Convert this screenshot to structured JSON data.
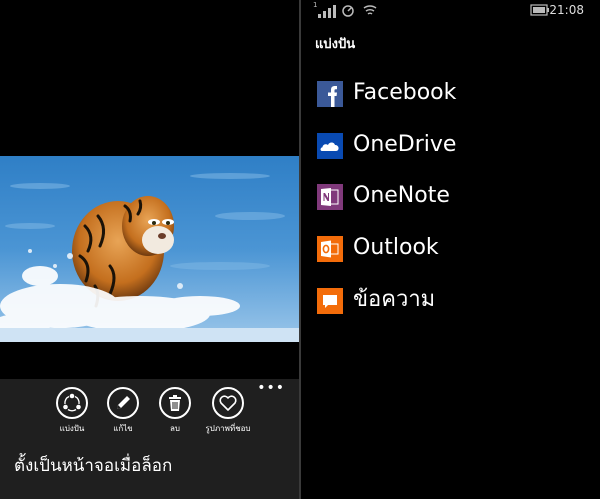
{
  "left_panel": {
    "photo": {
      "subject": "tiger running through water"
    },
    "more_glyph": "•••",
    "actions": [
      {
        "label": "แบ่งปัน",
        "icon": "share-icon"
      },
      {
        "label": "แก้ไข",
        "icon": "pencil-icon"
      },
      {
        "label": "ลบ",
        "icon": "trash-icon"
      },
      {
        "label": "รูปภาพที่ชอบ",
        "icon": "heart-icon"
      }
    ],
    "lock_screen_link": "ตั้งเป็นหน้าจอเมื่อล็อก"
  },
  "right_panel": {
    "status_bar": {
      "signal_badge": "1",
      "time": "21:08"
    },
    "title": "แบ่งปัน",
    "share_targets": [
      {
        "label": "Facebook",
        "icon": "facebook-icon",
        "color": "#3b5998"
      },
      {
        "label": "OneDrive",
        "icon": "onedrive-icon",
        "color": "#094ab2"
      },
      {
        "label": "OneNote",
        "icon": "onenote-icon",
        "color": "#80397b"
      },
      {
        "label": "Outlook",
        "icon": "outlook-icon",
        "color": "#0072c6"
      },
      {
        "label": "ข้อความ",
        "icon": "messaging-icon",
        "color": "#f36c0a"
      }
    ]
  }
}
